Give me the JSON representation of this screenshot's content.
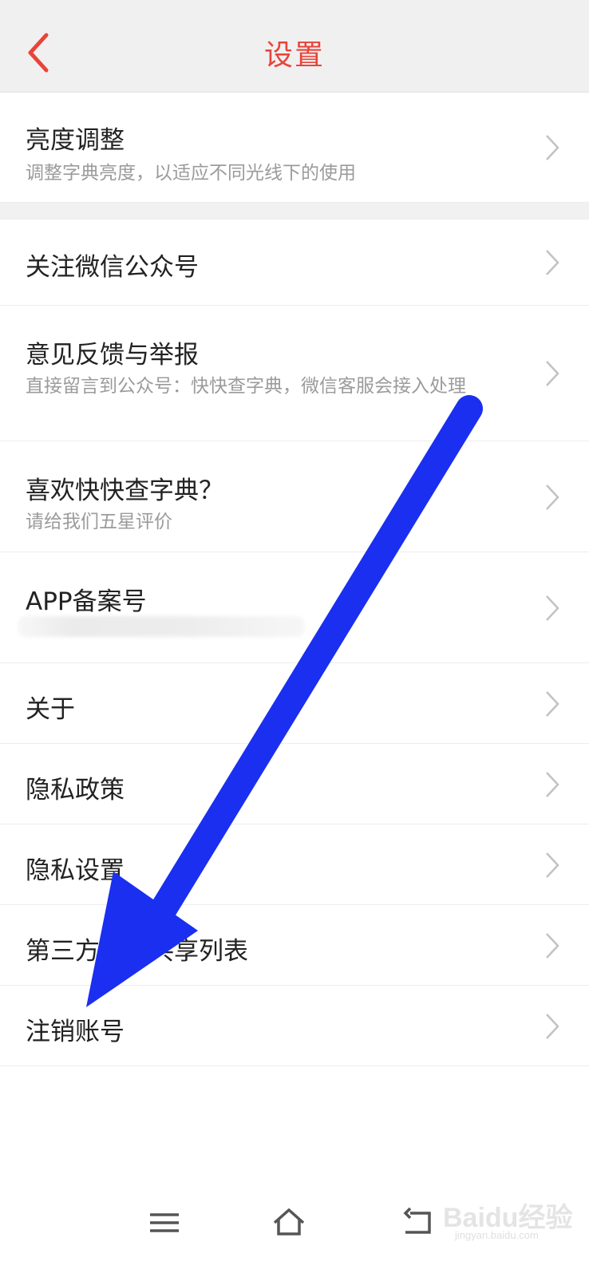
{
  "header": {
    "title": "设置"
  },
  "items": [
    {
      "label": "亮度调整",
      "sub": "调整字典亮度，以适应不同光线下的使用"
    },
    {
      "label": "关注微信公众号"
    },
    {
      "label": "意见反馈与举报",
      "sub": "直接留言到公众号：快快查字典，微信客服会接入处理"
    },
    {
      "label": "喜欢快快查字典？",
      "sub": "请给我们五星评价"
    },
    {
      "label": "APP备案号"
    },
    {
      "label": "关于"
    },
    {
      "label": "隐私政策"
    },
    {
      "label": "隐私设置"
    },
    {
      "label": "第三方信息共享列表"
    },
    {
      "label": "注销账号"
    }
  ],
  "watermark": {
    "brand": "Baidu经验",
    "url": "jingyan.baidu.com"
  },
  "colors": {
    "accent": "#e8443a",
    "arrow": "#1a2ff0"
  }
}
